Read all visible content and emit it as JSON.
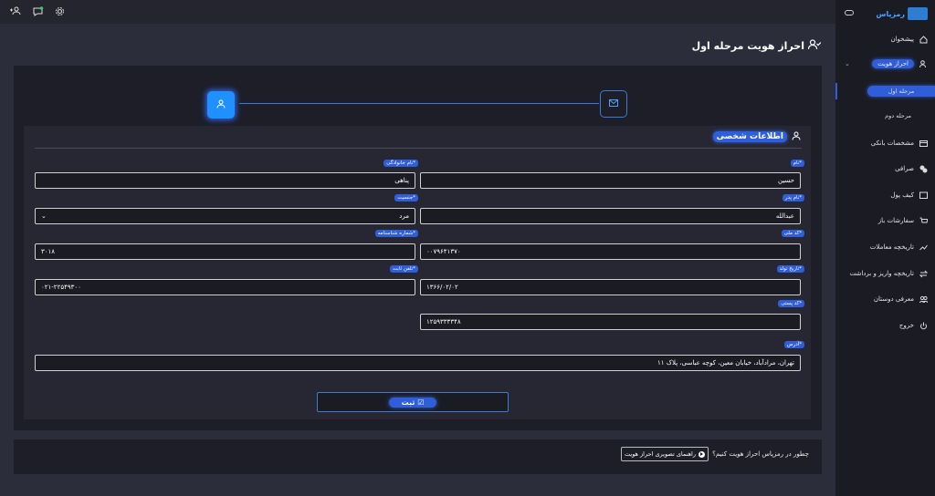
{
  "sidebar": {
    "logo_text": "رمزپاس",
    "items": [
      {
        "label": "پیشخوان",
        "icon": "home-icon"
      },
      {
        "label": "احراز هویت",
        "icon": "user-check-icon"
      },
      {
        "label": "مشخصات بانکی",
        "icon": "card-icon"
      },
      {
        "label": "صرافی",
        "icon": "exchange-icon"
      },
      {
        "label": "کیف پول",
        "icon": "wallet-icon"
      },
      {
        "label": "سفارشات باز",
        "icon": "cart-icon"
      },
      {
        "label": "تاریخچه معاملات",
        "icon": "chart-icon"
      },
      {
        "label": "تاریخچه واریز و برداشت",
        "icon": "transfer-icon"
      },
      {
        "label": "معرفی دوستان",
        "icon": "users-icon"
      },
      {
        "label": "خروج",
        "icon": "power-icon"
      }
    ],
    "sub_items": [
      {
        "label": "مرحله اول"
      },
      {
        "label": "مرحله دوم"
      }
    ]
  },
  "page": {
    "title": "احراز هویت مرحله اول"
  },
  "form": {
    "section_title": "اطلاعات شخصی",
    "fields": {
      "first_name": {
        "label": "نام*",
        "value": "حسین"
      },
      "last_name": {
        "label": "نام خانوادگی*",
        "value": "پناهی"
      },
      "father_name": {
        "label": "نام پدر*",
        "value": "عبدالله"
      },
      "gender": {
        "label": "جنسیت*",
        "value": "مرد"
      },
      "national_code": {
        "label": "کد ملی*",
        "value": "۰۰۷۹۶۴۱۳۷۰"
      },
      "id_number": {
        "label": "شماره شناسنامه*",
        "value": "۳۰۱۸"
      },
      "birth_date": {
        "label": "تاریخ تولد*",
        "value": "۱۳۶۶/۰۲/۰۲"
      },
      "phone": {
        "label": "تلفن ثابت*",
        "value": "۰۲۱-۲۲۵۴۹۳۰۰"
      },
      "postal_code": {
        "label": "کد پستی*",
        "value": "۱۲۵۹۳۳۳۳۴۸"
      },
      "address": {
        "label": "آدرس*",
        "value": "تهران، مرادآباد، خیابان معین، کوچه عباسی، پلاک ۱۱"
      }
    },
    "submit_label": "ثبت"
  },
  "footer": {
    "question": "چطور در رمزپاس احراز هویت کنیم؟",
    "help_button": "راهنمای تصویری احراز هویت"
  }
}
